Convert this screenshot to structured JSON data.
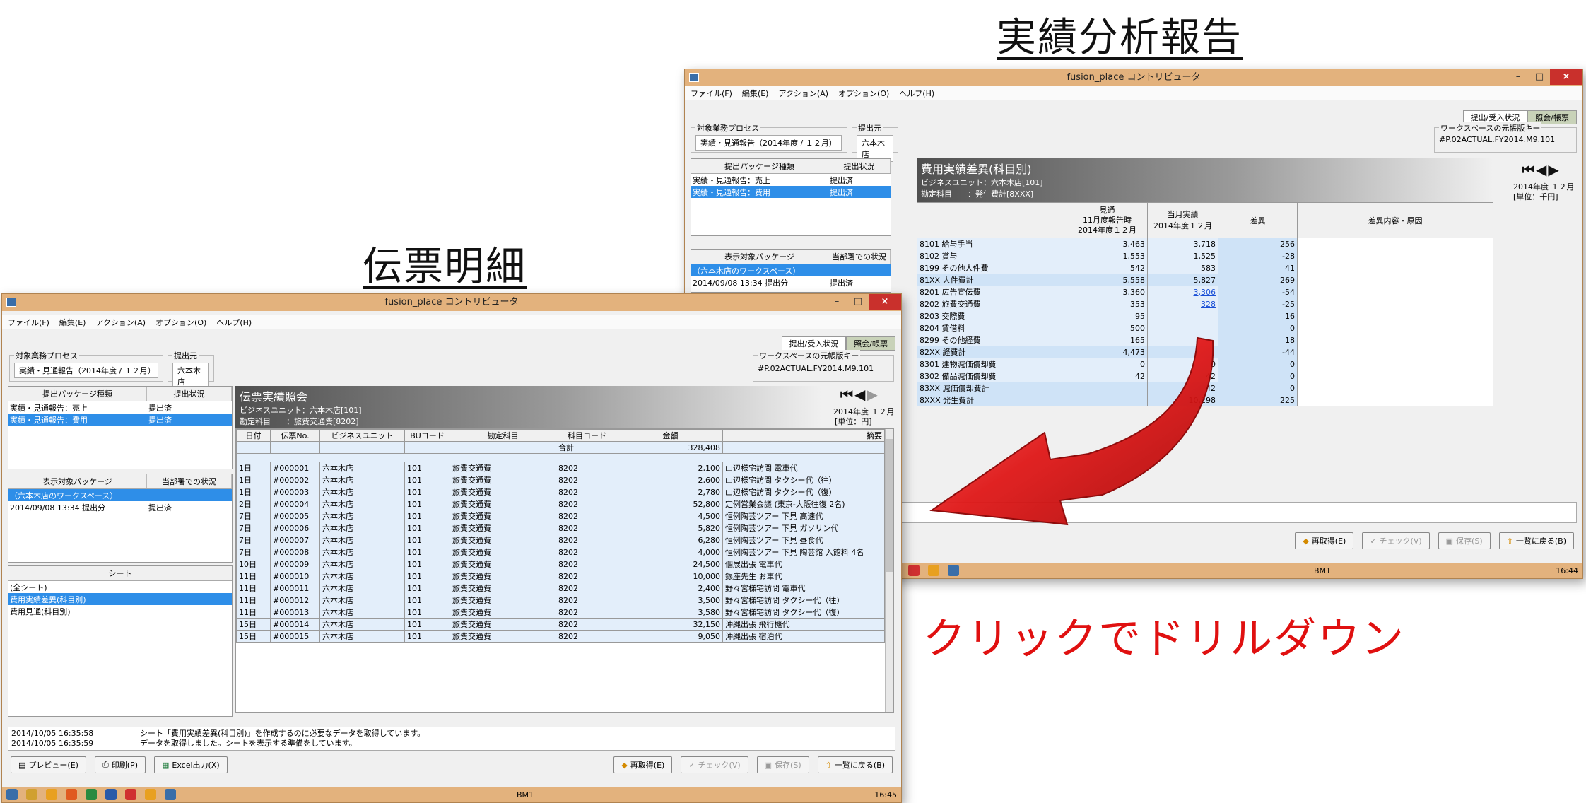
{
  "headings": {
    "right": "実績分析報告",
    "left": "伝票明細",
    "caption": "クリックでドリルダウン"
  },
  "common": {
    "window_title": "fusion_place コントリビュータ",
    "menu": [
      "ファイル(F)",
      "編集(E)",
      "アクション(A)",
      "オプション(O)",
      "ヘルプ(H)"
    ],
    "tabs": [
      "提出/受入状況",
      "照会/帳票"
    ],
    "process_label": "対象業務プロセス",
    "process_value": "実績・見通報告（2014年度 / １２月）",
    "source_label": "提出元",
    "source_value": "六本木店",
    "workspace_label": "ワークスペースの元帳版キー",
    "workspace_value": "#P.02ACTUAL.FY2014.M9.101",
    "pkg_headers": [
      "提出パッケージ種類",
      "提出状況"
    ],
    "pkg_rows": [
      {
        "name": "実績・見通報告：売上",
        "status": "提出済"
      },
      {
        "name": "実績・見通報告：費用",
        "status": "提出済"
      }
    ],
    "disp_headers": [
      "表示対象パッケージ",
      "当部署での状況"
    ],
    "disp_rows": [
      {
        "name": "（六本木店のワークスペース）",
        "status": ""
      },
      {
        "name": "2014/09/08 13:34 提出分",
        "status": "提出済"
      }
    ],
    "sheet_header": "シート",
    "sheet_rows": [
      "(全シート)",
      "費用実績差異(科目別)",
      "費用見通(科目別)"
    ],
    "buttons": [
      "再取得(E)",
      "チェック(V)",
      "保存(S)",
      "一覧に戻る(B)"
    ],
    "left_buttons": [
      "プレビュー(E)",
      "印刷(P)",
      "Excel出力(X)"
    ],
    "task_clock_left": "16:45",
    "task_clock_right": "16:44",
    "task_label": "BM1"
  },
  "left_report": {
    "title": "伝票実績照会",
    "meta1": "ビジネスユニット：六本木店[101]",
    "meta2": "勘定科目　　：旅費交通費[8202]",
    "period": "2014年度 １２月",
    "unit": "[単位：円]",
    "columns": [
      "日付",
      "伝票No.",
      "ビジネスユニット",
      "BUコード",
      "勘定科目",
      "科目コード",
      "金額",
      "摘要"
    ],
    "total_label": "合計",
    "total_value": "328,408",
    "rows": [
      [
        "1日",
        "#000001",
        "六本木店",
        "101",
        "旅費交通費",
        "8202",
        "2,100",
        "山辺様宅訪問 電車代"
      ],
      [
        "1日",
        "#000002",
        "六本木店",
        "101",
        "旅費交通費",
        "8202",
        "2,600",
        "山辺様宅訪問 タクシー代（往）"
      ],
      [
        "1日",
        "#000003",
        "六本木店",
        "101",
        "旅費交通費",
        "8202",
        "2,780",
        "山辺様宅訪問 タクシー代（復）"
      ],
      [
        "2日",
        "#000004",
        "六本木店",
        "101",
        "旅費交通費",
        "8202",
        "52,800",
        "定例営業会議 (東京-大阪往復 2名)"
      ],
      [
        "7日",
        "#000005",
        "六本木店",
        "101",
        "旅費交通費",
        "8202",
        "4,500",
        "恒例陶芸ツアー 下見 高速代"
      ],
      [
        "7日",
        "#000006",
        "六本木店",
        "101",
        "旅費交通費",
        "8202",
        "5,820",
        "恒例陶芸ツアー 下見 ガソリン代"
      ],
      [
        "7日",
        "#000007",
        "六本木店",
        "101",
        "旅費交通費",
        "8202",
        "6,280",
        "恒例陶芸ツアー 下見 昼食代"
      ],
      [
        "7日",
        "#000008",
        "六本木店",
        "101",
        "旅費交通費",
        "8202",
        "4,000",
        "恒例陶芸ツアー 下見 陶芸館 入館料 4名"
      ],
      [
        "10日",
        "#000009",
        "六本木店",
        "101",
        "旅費交通費",
        "8202",
        "24,500",
        "個展出張 電車代"
      ],
      [
        "11日",
        "#000010",
        "六本木店",
        "101",
        "旅費交通費",
        "8202",
        "10,000",
        "銀座先生 お車代"
      ],
      [
        "11日",
        "#000011",
        "六本木店",
        "101",
        "旅費交通費",
        "8202",
        "2,400",
        "野々宮様宅訪問 電車代"
      ],
      [
        "11日",
        "#000012",
        "六本木店",
        "101",
        "旅費交通費",
        "8202",
        "3,500",
        "野々宮様宅訪問 タクシー代（往）"
      ],
      [
        "11日",
        "#000013",
        "六本木店",
        "101",
        "旅費交通費",
        "8202",
        "3,580",
        "野々宮様宅訪問 タクシー代（復）"
      ],
      [
        "15日",
        "#000014",
        "六本木店",
        "101",
        "旅費交通費",
        "8202",
        "32,150",
        "沖縄出張 飛行機代"
      ],
      [
        "15日",
        "#000015",
        "六本木店",
        "101",
        "旅費交通費",
        "8202",
        "9,050",
        "沖縄出張 宿泊代"
      ]
    ],
    "status_lines": [
      {
        "time": "2014/10/05 16:35:58",
        "msg": "シート「費用実績差異(科目別)」を作成するのに必要なデータを取得しています。"
      },
      {
        "time": "2014/10/05 16:35:59",
        "msg": "データを取得しました。シートを表示する準備をしています。"
      }
    ]
  },
  "right_report": {
    "title": "費用実績差異(科目別)",
    "meta1": "ビジネスユニット：六本木店[101]",
    "meta2": "勘定科目　　：発生費計[8XXX]",
    "period": "2014年度 １２月",
    "unit": "[単位：千円]",
    "col_headers": [
      "見通\n11月度報告時\n2014年度１２月",
      "当月実績\n2014年度１２月",
      "差異",
      "差異内容・原因"
    ],
    "rows": [
      {
        "name": "8101 給与手当",
        "a": "3,463",
        "b": "3,718",
        "d": "256",
        "sum": false
      },
      {
        "name": "8102 賞与",
        "a": "1,553",
        "b": "1,525",
        "d": "-28",
        "sum": false
      },
      {
        "name": "8199 その他人件費",
        "a": "542",
        "b": "583",
        "d": "41",
        "sum": false
      },
      {
        "name": "81XX 人件費計",
        "a": "5,558",
        "b": "5,827",
        "d": "269",
        "sum": true
      },
      {
        "name": "8201 広告宣伝費",
        "a": "3,360",
        "b": "3,306",
        "d": "-54",
        "sum": false,
        "link": true
      },
      {
        "name": "8202 旅費交通費",
        "a": "353",
        "b": "328",
        "d": "-25",
        "sum": false,
        "link": true
      },
      {
        "name": "8203 交際費",
        "a": "95",
        "b": "",
        "d": "16",
        "sum": false
      },
      {
        "name": "8204 賃借料",
        "a": "500",
        "b": "",
        "d": "0",
        "sum": false
      },
      {
        "name": "8299 その他経費",
        "a": "165",
        "b": "",
        "d": "18",
        "sum": false
      },
      {
        "name": "82XX 経費計",
        "a": "4,473",
        "b": "",
        "d": "-44",
        "sum": true
      },
      {
        "name": "8301 建物減価償却費",
        "a": "0",
        "b": "0",
        "d": "0",
        "sum": false
      },
      {
        "name": "8302 備品減価償却費",
        "a": "42",
        "b": "42",
        "d": "0",
        "sum": false
      },
      {
        "name": "83XX 減価償却費計",
        "a": "",
        "b": "42",
        "d": "0",
        "sum": true
      },
      {
        "name": "8XXX 発生費計",
        "a": "",
        "b": "10,298",
        "d": "225",
        "sum": true
      }
    ]
  }
}
